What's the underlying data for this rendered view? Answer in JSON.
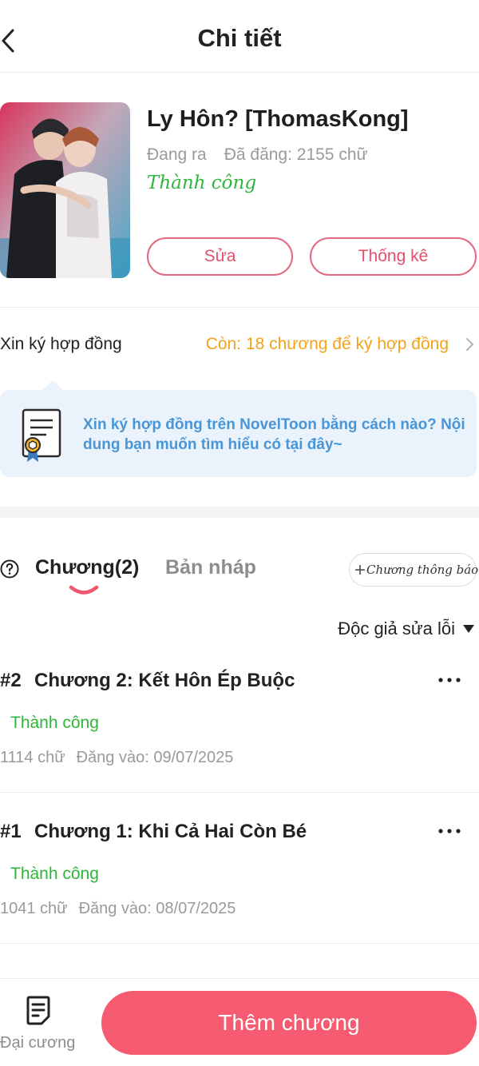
{
  "header": {
    "title": "Chi tiết",
    "back_icon": "back-arrow-icon"
  },
  "novel": {
    "title": "Ly Hôn? [ThomasKong]",
    "publish_state": "Đang ra",
    "word_count": "Đã đăng: 2155 chữ",
    "review_status": "Thành công",
    "edit_label": "Sửa",
    "stats_label": "Thống kê"
  },
  "contract": {
    "label": "Xin ký hợp đồng",
    "remaining": "Còn: 18 chương để ký hợp đồng",
    "info_text": "Xin ký hợp đồng trên NovelToon bằng cách nào? Nội dung bạn muốn tìm hiểu có tại đây~"
  },
  "tabs": {
    "chapters": "Chương(2)",
    "drafts": "Bản nháp",
    "announce": "Chương thông báo"
  },
  "filter": {
    "label": "Độc giả sửa lỗi"
  },
  "chapters": [
    {
      "num": "#2",
      "title": "Chương 2: Kết Hôn Ép Buộc",
      "status": "Thành công",
      "words": "1114 chữ",
      "date": "Đăng vào:  09/07/2025"
    },
    {
      "num": "#1",
      "title": "Chương 1: Khi Cả Hai Còn Bé",
      "status": "Thành công",
      "words": "1041 chữ",
      "date": "Đăng vào:  08/07/2025"
    }
  ],
  "bottom": {
    "outline_label": "Đại cương",
    "add_chapter_label": "Thêm chương"
  },
  "colors": {
    "accent": "#f65b71",
    "success": "#2eb63b",
    "warning": "#f2a31c",
    "info": "#4a95d6"
  }
}
